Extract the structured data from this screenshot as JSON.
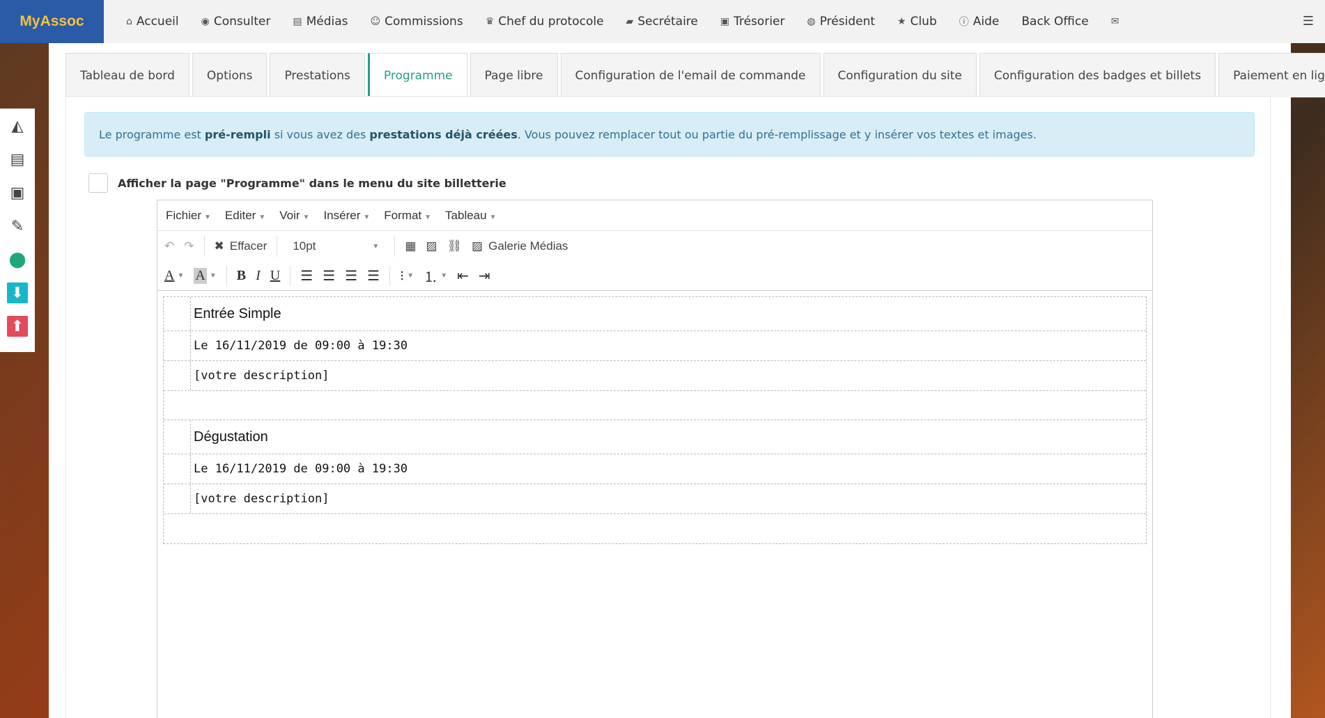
{
  "brand": "MyAssoc",
  "nav": [
    {
      "label": "Accueil",
      "icon": "home-icon",
      "glyph": "⌂"
    },
    {
      "label": "Consulter",
      "icon": "eye-icon",
      "glyph": "◉"
    },
    {
      "label": "Médias",
      "icon": "file-icon",
      "glyph": "▤"
    },
    {
      "label": "Commissions",
      "icon": "user-circle-icon",
      "glyph": "☺"
    },
    {
      "label": "Chef du protocole",
      "icon": "trophy-icon",
      "glyph": "♛"
    },
    {
      "label": "Secrétaire",
      "icon": "book-icon",
      "glyph": "▰"
    },
    {
      "label": "Trésorier",
      "icon": "money-icon",
      "glyph": "▣"
    },
    {
      "label": "Président",
      "icon": "globe-icon",
      "glyph": "◍"
    },
    {
      "label": "Club",
      "icon": "star-icon",
      "glyph": "★"
    },
    {
      "label": "Aide",
      "icon": "info-icon",
      "glyph": "ⓘ"
    },
    {
      "label": "Back Office",
      "icon": "",
      "glyph": ""
    },
    {
      "label": "",
      "icon": "envelope-icon",
      "glyph": "✉"
    }
  ],
  "tabs": [
    {
      "label": "Tableau de bord"
    },
    {
      "label": "Options"
    },
    {
      "label": "Prestations"
    },
    {
      "label": "Programme",
      "active": true
    },
    {
      "label": "Page libre"
    },
    {
      "label": "Configuration de l'email de commande"
    },
    {
      "label": "Configuration du site"
    },
    {
      "label": "Configuration des badges et billets"
    },
    {
      "label": "Paiement en ligne"
    }
  ],
  "alert": {
    "part1": "Le programme est ",
    "bold1": "pré-rempli",
    "part2": " si vous avez des ",
    "bold2": "prestations déjà créées",
    "part3": ". Vous pouvez remplacer tout ou partie du pré-remplissage et y insérer vos textes et images."
  },
  "checkbox_label": "Afficher la page \"Programme\" dans le menu du site billetterie",
  "editor": {
    "menus": [
      "Fichier",
      "Editer",
      "Voir",
      "Insérer",
      "Format",
      "Tableau"
    ],
    "clear_label": "Effacer",
    "font_size": "10pt",
    "gallery_label": "Galerie Médias",
    "items": [
      {
        "title": "Entrée Simple",
        "date": "Le 16/11/2019 de 09:00 à 19:30",
        "desc": "[votre description]"
      },
      {
        "title": "Dégustation",
        "date": "Le 16/11/2019 de 09:00 à 19:30",
        "desc": "[votre description]"
      }
    ]
  },
  "colors": {
    "brand_bg": "#2b5aa6",
    "brand_fg": "#f5c33b",
    "accent": "#1fa08a",
    "alert_bg": "#d9edf7"
  }
}
